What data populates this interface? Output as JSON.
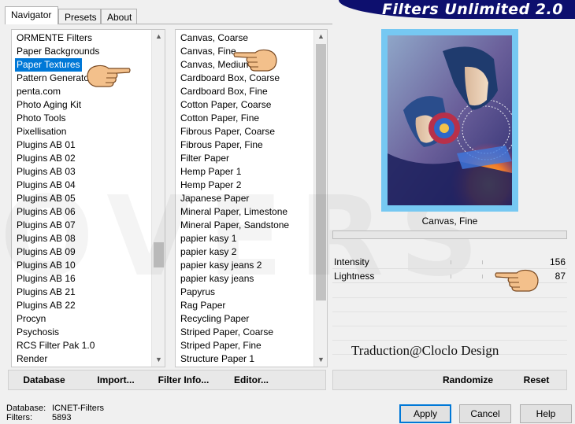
{
  "app": {
    "title": "Filters Unlimited 2.0",
    "watermark": "OVERS"
  },
  "tabs": [
    {
      "label": "Navigator",
      "active": true
    },
    {
      "label": "Presets",
      "active": false
    },
    {
      "label": "About",
      "active": false
    }
  ],
  "categories": {
    "selected_index": 2,
    "items": [
      "ORMENTE Filters",
      "Paper Backgrounds",
      "Paper Textures",
      "Pattern Generators",
      "penta.com",
      "Photo Aging Kit",
      "Photo Tools",
      "Pixellisation",
      "Plugins AB 01",
      "Plugins AB 02",
      "Plugins AB 03",
      "Plugins AB 04",
      "Plugins AB 05",
      "Plugins AB 06",
      "Plugins AB 07",
      "Plugins AB 08",
      "Plugins AB 09",
      "Plugins AB 10",
      "Plugins AB 16",
      "Plugins AB 21",
      "Plugins AB 22",
      "Procyn",
      "Psychosis",
      "RCS Filter Pak 1.0",
      "Render"
    ]
  },
  "filters": {
    "items": [
      "Canvas, Coarse",
      "Canvas, Fine",
      "Canvas, Medium",
      "Cardboard Box, Coarse",
      "Cardboard Box, Fine",
      "Cotton Paper, Coarse",
      "Cotton Paper, Fine",
      "Fibrous Paper, Coarse",
      "Fibrous Paper, Fine",
      "Filter Paper",
      "Hemp Paper 1",
      "Hemp Paper 2",
      "Japanese Paper",
      "Mineral Paper, Limestone",
      "Mineral Paper, Sandstone",
      "papier kasy 1",
      "papier kasy 2",
      "papier kasy jeans 2",
      "papier kasy jeans",
      "Papyrus",
      "Rag Paper",
      "Recycling Paper",
      "Striped Paper, Coarse",
      "Striped Paper, Fine",
      "Structure Paper 1"
    ]
  },
  "preview": {
    "filter_name": "Canvas, Fine"
  },
  "parameters": [
    {
      "label": "Intensity",
      "value": "156"
    },
    {
      "label": "Lightness",
      "value": "87"
    }
  ],
  "credit": "Traduction@Cloclo Design",
  "left_buttons": {
    "database": "Database",
    "import": "Import...",
    "filter_info": "Filter Info...",
    "editor": "Editor..."
  },
  "right_buttons": {
    "randomize": "Randomize",
    "reset": "Reset"
  },
  "status": {
    "database_label": "Database:",
    "database_value": "ICNET-Filters",
    "filters_label": "Filters:",
    "filters_value": "5893"
  },
  "dialog_buttons": {
    "apply": "Apply",
    "cancel": "Cancel",
    "help": "Help"
  },
  "colors": {
    "banner": "#0d0f6e",
    "selection": "#0078d7",
    "preview_frame": "#76c8f2"
  }
}
